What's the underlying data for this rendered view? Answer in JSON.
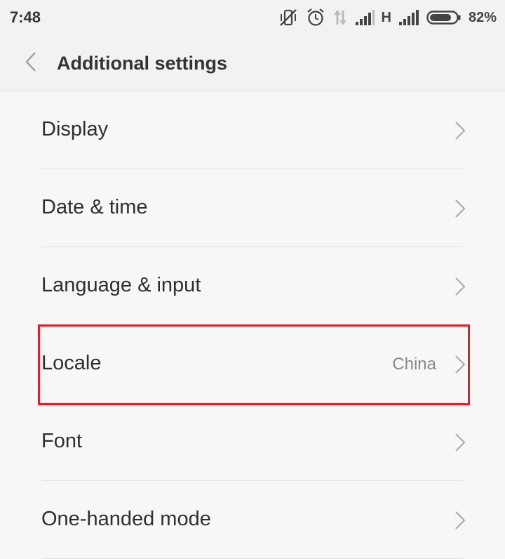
{
  "status_bar": {
    "time": "7:48",
    "network_type": "H",
    "battery_percent": "82%",
    "battery_level": 0.82,
    "icons": [
      "vibrate-off-icon",
      "alarm-icon",
      "data-arrows-icon",
      "signal-icon",
      "signal-icon",
      "battery-icon"
    ]
  },
  "header": {
    "title": "Additional settings",
    "back_icon": "chevron-left-icon"
  },
  "items": [
    {
      "label": "Display",
      "value": ""
    },
    {
      "label": "Date & time",
      "value": ""
    },
    {
      "label": "Language & input",
      "value": ""
    },
    {
      "label": "Locale",
      "value": "China"
    },
    {
      "label": "Font",
      "value": ""
    },
    {
      "label": "One-handed mode",
      "value": ""
    }
  ],
  "colors": {
    "highlight": "#e31e24",
    "background": "#f7f7f7",
    "header_background": "#f2f2f2"
  }
}
